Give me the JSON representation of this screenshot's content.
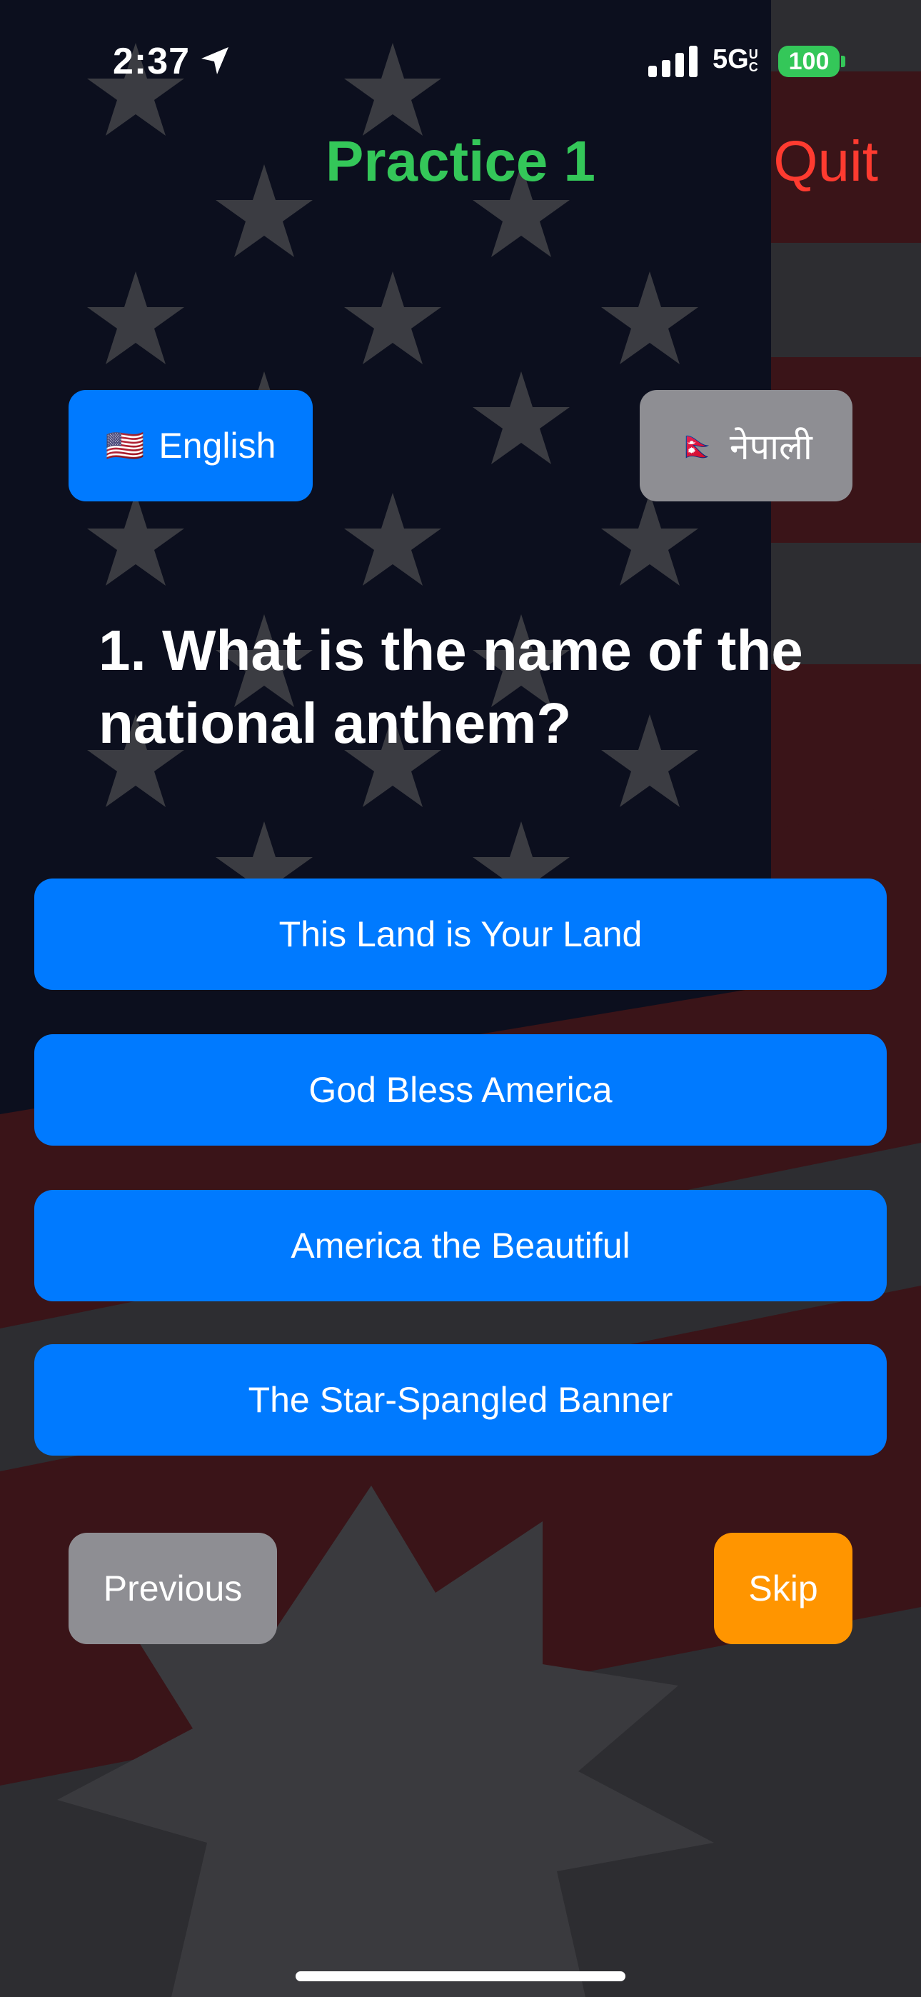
{
  "status_bar": {
    "time": "2:37",
    "network": "5G",
    "network_suffix": "UC",
    "battery": "100"
  },
  "header": {
    "title": "Practice 1",
    "quit_label": "Quit"
  },
  "languages": [
    {
      "flag": "🇺🇸",
      "label": "English",
      "selected": true
    },
    {
      "flag": "🇳🇵",
      "label": "नेपाली",
      "selected": false
    }
  ],
  "question": {
    "text": "1. What is the name of the national anthem?"
  },
  "answers": [
    "This Land is Your Land",
    "God Bless America",
    "America the Beautiful",
    "The Star-Spangled Banner"
  ],
  "navigation": {
    "previous_label": "Previous",
    "skip_label": "Skip"
  },
  "colors": {
    "accent_blue": "#007aff",
    "title_green": "#34c759",
    "quit_red": "#ff3b30",
    "skip_orange": "#ff9500",
    "inactive_gray": "#8e8e93"
  }
}
